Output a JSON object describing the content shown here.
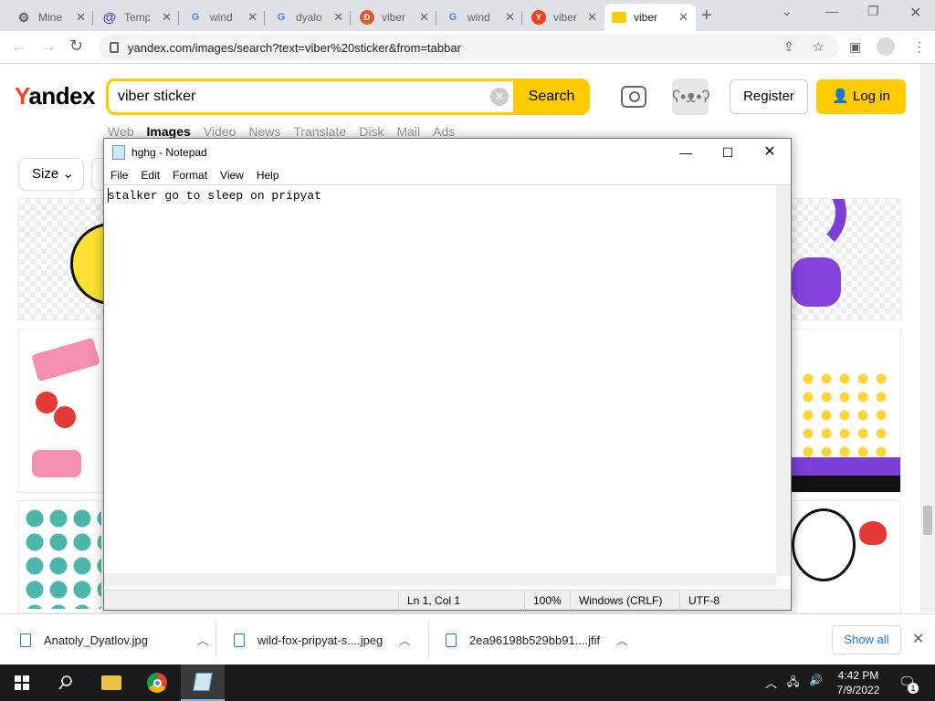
{
  "browser": {
    "tabs": [
      {
        "title": "Mine",
        "favicon": "gear-icon",
        "color": "#5f6368"
      },
      {
        "title": "Temp",
        "favicon": "at-icon",
        "color": "#5f3dc4"
      },
      {
        "title": "wind",
        "favicon": "google-icon",
        "color": "#4285f4"
      },
      {
        "title": "dyalo",
        "favicon": "google-icon",
        "color": "#4285f4"
      },
      {
        "title": "viber",
        "favicon": "duckduckgo-icon",
        "color": "#de5833"
      },
      {
        "title": "wind",
        "favicon": "google-icon",
        "color": "#4285f4"
      },
      {
        "title": "viber",
        "favicon": "yandex-icon",
        "color": "#fc3f1d"
      },
      {
        "title": "viber",
        "favicon": "yandex-images-icon",
        "color": "#fc0",
        "active": true
      }
    ],
    "url": "yandex.com/images/search?text=viber%20sticker&from=tabbar"
  },
  "yandex": {
    "logo_first": "Y",
    "logo_rest": "andex",
    "query": "viber sticker",
    "search_button": "Search",
    "register": "Register",
    "login": "Log in",
    "nav_tabs": [
      "Web",
      "Images",
      "Video",
      "News",
      "Translate",
      "Disk",
      "Mail",
      "Ads"
    ],
    "active_tab": "Images",
    "filter_size": "Size",
    "accent": "#ffcc00"
  },
  "notepad": {
    "title": "hghg - Notepad",
    "menu": [
      "File",
      "Edit",
      "Format",
      "View",
      "Help"
    ],
    "content": "stalker go to sleep on pripyat",
    "status": {
      "position": "Ln 1, Col 1",
      "zoom": "100%",
      "line_ending": "Windows (CRLF)",
      "encoding": "UTF-8"
    }
  },
  "downloads": {
    "items": [
      "Anatoly_Dyatlov.jpg",
      "wild-fox-pripyat-s....jpeg",
      "2ea96198b529bb91....jfif"
    ],
    "show_all": "Show all"
  },
  "taskbar": {
    "time": "4:42 PM",
    "date": "7/9/2022",
    "notification_count": "1"
  }
}
